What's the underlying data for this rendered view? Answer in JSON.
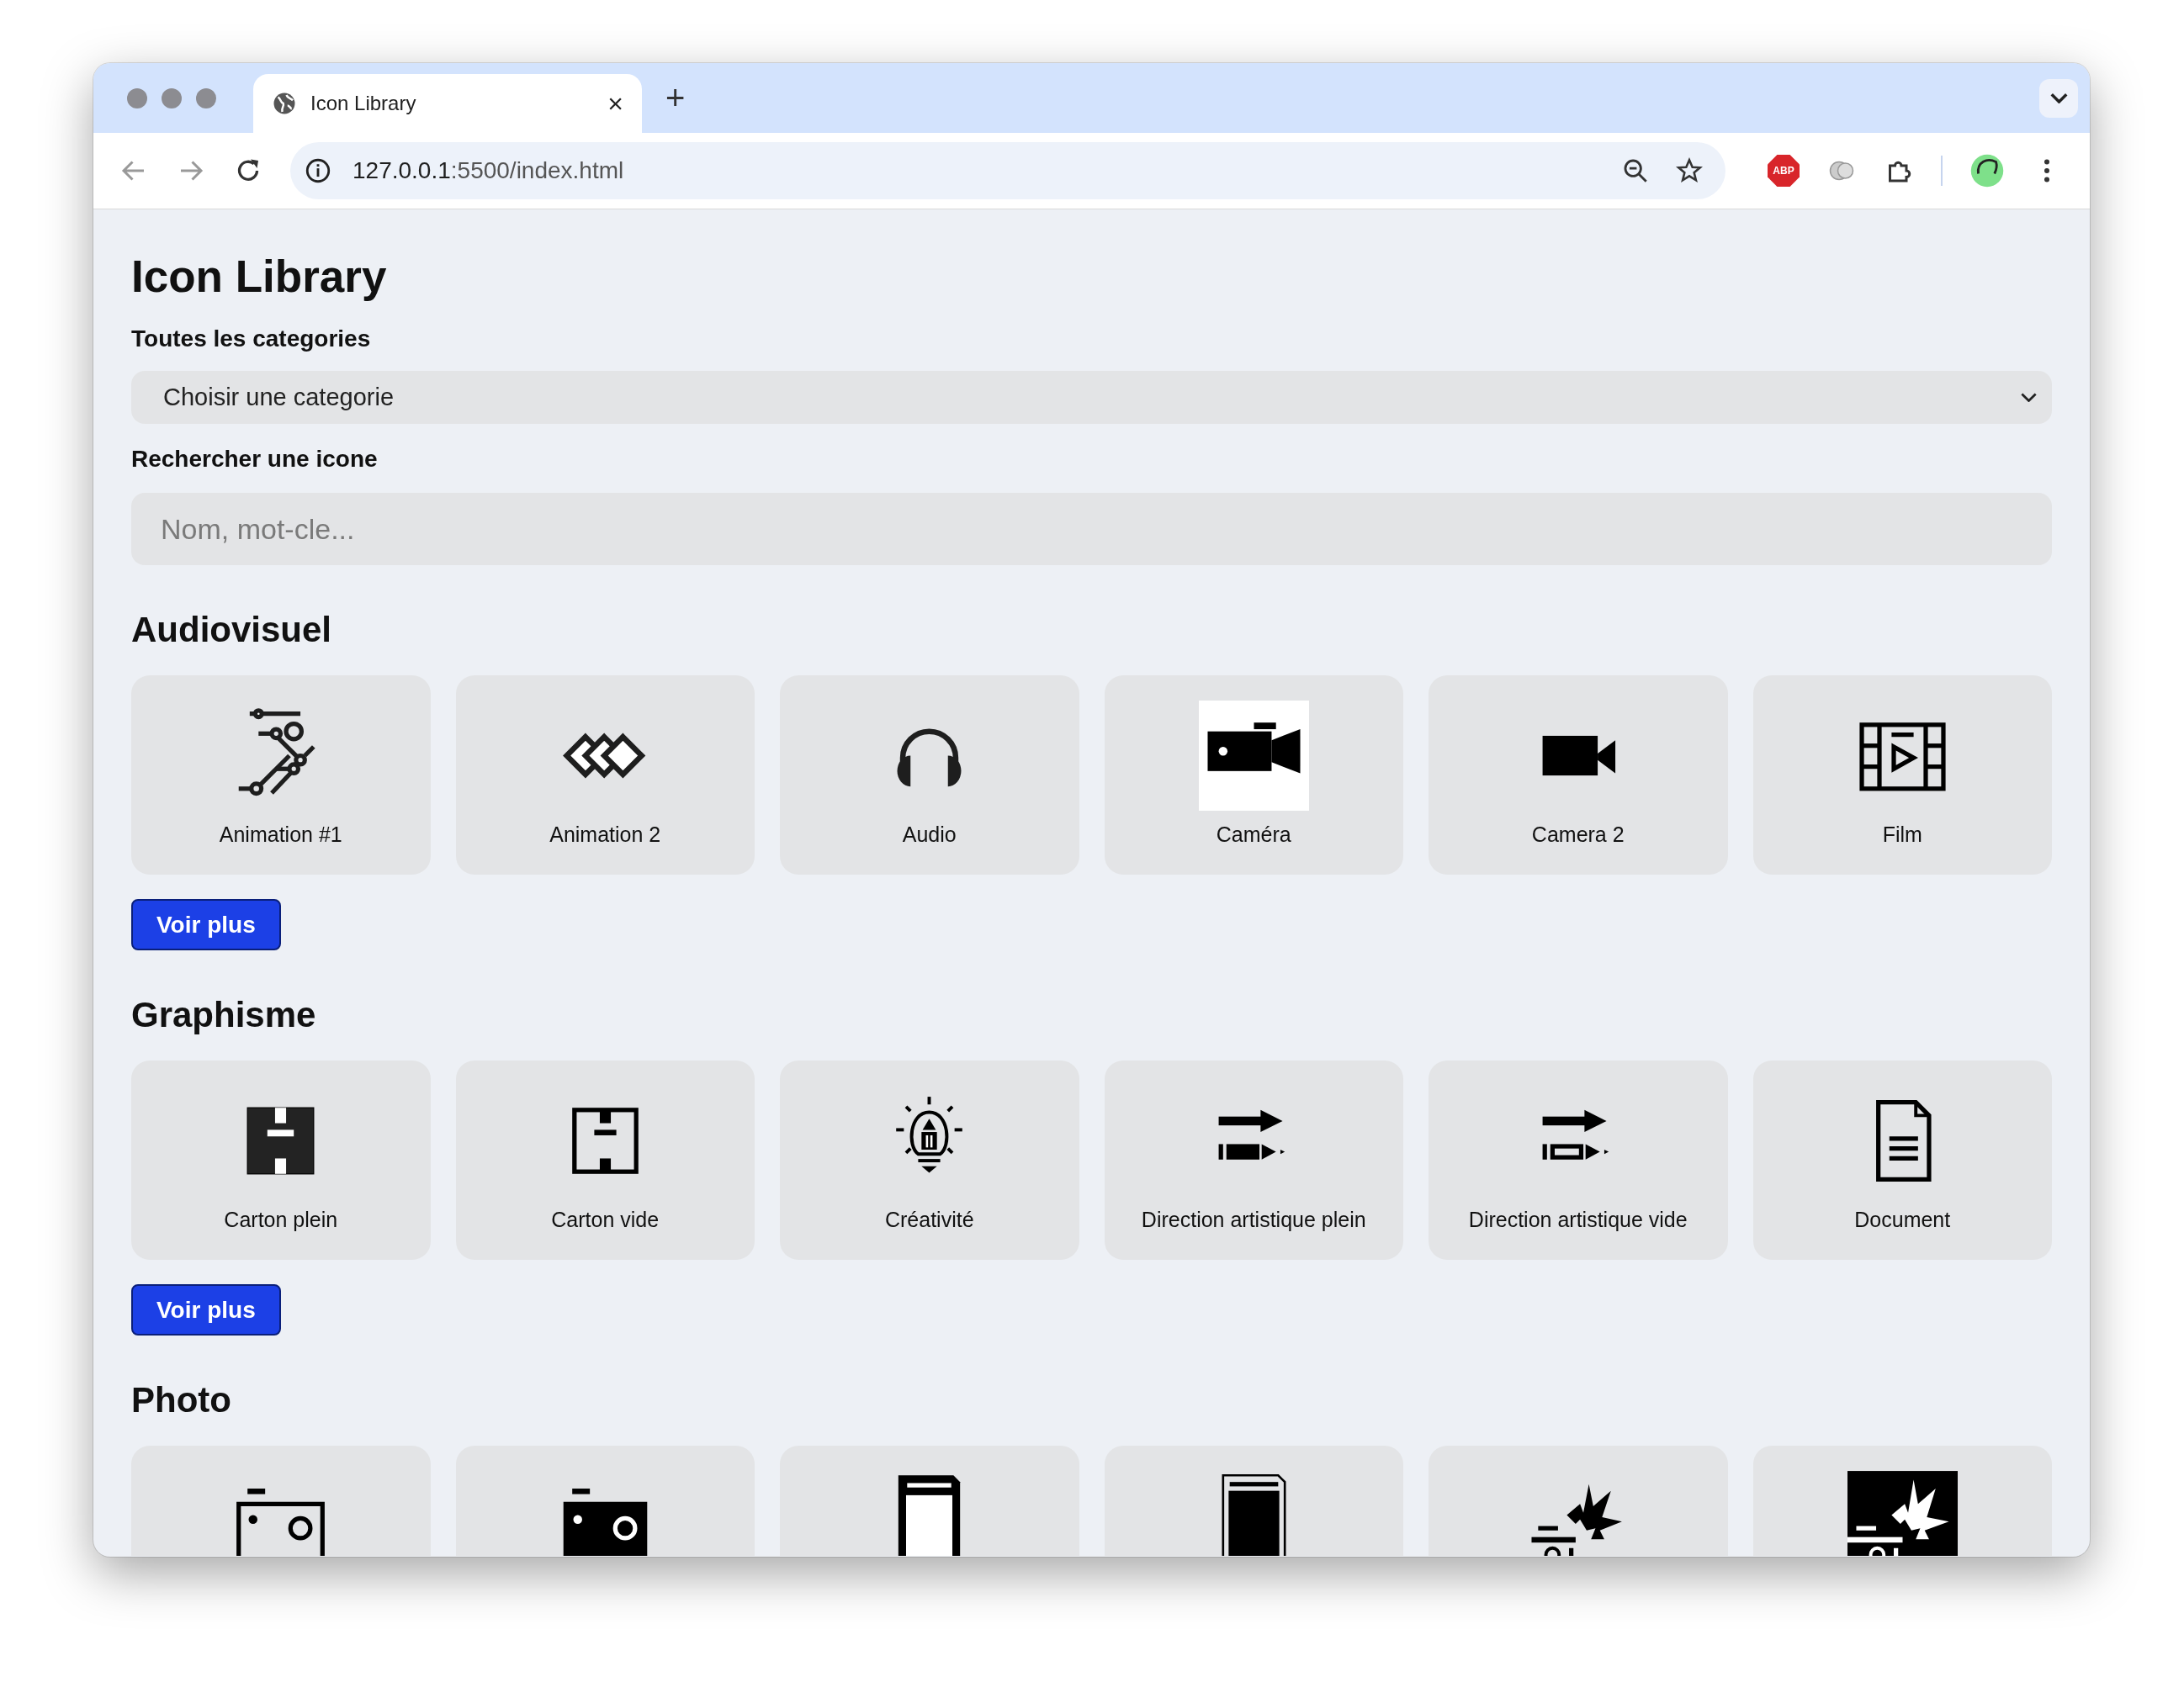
{
  "browser": {
    "tab": {
      "title": "Icon Library",
      "close": "×"
    },
    "new_tab": "+",
    "url": {
      "host": "127.0.0.1",
      "path": ":5500/index.html"
    },
    "extension_badge": "ABP"
  },
  "page": {
    "title": "Icon Library",
    "category_label": "Toutes les categories",
    "category_select": {
      "value": "Choisir une categorie"
    },
    "search_label": "Rechercher une icone",
    "search": {
      "placeholder": "Nom, mot-cle..."
    }
  },
  "sections": [
    {
      "title": "Audiovisuel",
      "button": "Voir plus",
      "items": [
        {
          "kind": "labeled",
          "label": "Animation #1"
        },
        {
          "kind": "labeled",
          "label": "Animation 2"
        },
        {
          "kind": "labeled",
          "label": "Audio"
        },
        {
          "kind": "labeled",
          "label": "Caméra"
        },
        {
          "kind": "labeled",
          "label": "Camera 2"
        },
        {
          "kind": "labeled",
          "label": "Film"
        }
      ]
    },
    {
      "title": "Graphisme",
      "button": "Voir plus",
      "items": [
        {
          "kind": "labeled",
          "label": "Carton plein"
        },
        {
          "kind": "labeled",
          "label": "Carton vide"
        },
        {
          "kind": "labeled",
          "label": "Créativité"
        },
        {
          "kind": "labeled",
          "label": "Direction artistique plein"
        },
        {
          "kind": "labeled",
          "label": "Direction artistique vide"
        },
        {
          "kind": "labeled",
          "label": "Document"
        }
      ]
    },
    {
      "title": "Photo",
      "items": [
        {
          "kind": "clipped"
        },
        {
          "kind": "clipped"
        },
        {
          "kind": "clipped"
        },
        {
          "kind": "clipped"
        },
        {
          "kind": "clipped"
        },
        {
          "kind": "clipped"
        }
      ]
    }
  ]
}
